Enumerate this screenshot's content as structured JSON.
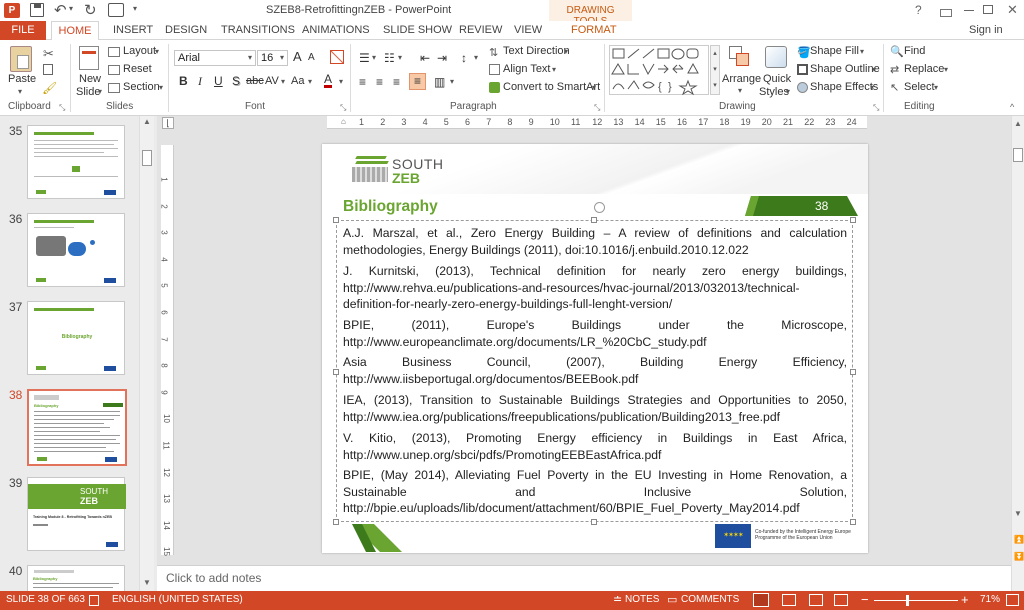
{
  "titlebar": {
    "title": "SZEB8-RetrofittingnZEB - PowerPoint",
    "context_group": "DRAWING TOOLS",
    "help": "?",
    "sign_in": "Sign in"
  },
  "tabs": [
    "FILE",
    "HOME",
    "INSERT",
    "DESIGN",
    "TRANSITIONS",
    "ANIMATIONS",
    "SLIDE SHOW",
    "REVIEW",
    "VIEW",
    "FORMAT"
  ],
  "ribbon": {
    "clipboard": {
      "label": "Clipboard",
      "paste": "Paste"
    },
    "slides": {
      "label": "Slides",
      "new_slide_1": "New",
      "new_slide_2": "Slide",
      "layout": "Layout",
      "reset": "Reset",
      "section": "Section"
    },
    "font": {
      "label": "Font",
      "font_name": "Arial",
      "font_size": "16",
      "bold": "B",
      "italic": "I",
      "underline": "U",
      "shadow": "S",
      "strike": "abc",
      "spacing": "AV",
      "case": "Aa",
      "color": "A",
      "grow": "A",
      "shrink": "A"
    },
    "paragraph": {
      "label": "Paragraph",
      "text_direction": "Text Direction",
      "align_text": "Align Text",
      "smartart": "Convert to SmartArt"
    },
    "drawing": {
      "label": "Drawing",
      "arrange": "Arrange",
      "quick_styles_1": "Quick",
      "quick_styles_2": "Styles",
      "shape_fill": "Shape Fill",
      "shape_outline": "Shape Outline",
      "shape_effects": "Shape Effects"
    },
    "editing": {
      "label": "Editing",
      "find": "Find",
      "replace": "Replace",
      "select": "Select"
    }
  },
  "thumbnails": [
    {
      "num": "35",
      "caption": ""
    },
    {
      "num": "36",
      "caption": ""
    },
    {
      "num": "37",
      "caption": "Bibliography"
    },
    {
      "num": "38",
      "caption": "Bibliography"
    },
    {
      "num": "39",
      "caption": "Training Module 8 - Retrofitting Towards nZEB"
    },
    {
      "num": "40",
      "caption": "Bibliography"
    }
  ],
  "thumb_39_logo_1": "SOUTH",
  "thumb_39_logo_2": "ZEB",
  "ruler_ticks": [
    "1",
    "2",
    "3",
    "4",
    "5",
    "6",
    "7",
    "8",
    "9",
    "10",
    "11",
    "12",
    "13",
    "14",
    "15",
    "16",
    "17",
    "18",
    "19",
    "20",
    "21",
    "22",
    "23",
    "24"
  ],
  "vruler_ticks": [
    "1",
    "2",
    "3",
    "4",
    "5",
    "6",
    "7",
    "8",
    "9",
    "10",
    "11",
    "12",
    "13",
    "14",
    "15"
  ],
  "slide": {
    "logo_south": "SOUTH",
    "logo_zeb": "ZEB",
    "title": "Bibliography",
    "page_number": "38",
    "eu_text": "Co-funded by the Intelligent Energy Europe Programme of the European Union",
    "entries": [
      "A.J. Marszal, et al., Zero Energy Building – A review of definitions and calculation methodologies, Energy Buildings (2011), doi:10.1016/j.enbuild.2010.12.022",
      "J. Kurnitski, (2013), Technical definition for nearly zero energy buildings, http://www.rehva.eu/publications-and-resources/hvac-journal/2013/032013/technical-definition-for-nearly-zero-energy-buildings-full-lenght-version/",
      "BPIE, (2011), Europe's Buildings under the Microscope, http://www.europeanclimate.org/documents/LR_%20CbC_study.pdf",
      "Asia Business Council, (2007), Building Energy Efficiency, http://www.iisbeportugal.org/documentos/BEEBook.pdf",
      "IEA, (2013), Transition to Sustainable Buildings Strategies and Opportunities to 2050, http://www.iea.org/publications/freepublications/publication/Building2013_free.pdf",
      "V. Kitio, (2013), Promoting Energy efficiency in Buildings in East Africa, http://www.unep.org/sbci/pdfs/PromotingEEBEastAfrica.pdf",
      "BPIE, (May 2014), Alleviating Fuel Poverty in the EU Investing in Home Renovation, a Sustainable and Inclusive Solution, http://bpie.eu/uploads/lib/document/attachment/60/BPIE_Fuel_Poverty_May2014.pdf"
    ]
  },
  "notes_placeholder": "Click to add notes",
  "status": {
    "slide_counter": "SLIDE 38 OF 663",
    "language": "ENGLISH (UNITED STATES)",
    "notes": "NOTES",
    "comments": "COMMENTS",
    "zoom": "71%"
  },
  "colors": {
    "accent": "#d24726",
    "green": "#6aa531",
    "dark_green": "#3d7a1c",
    "context": "#c55a11"
  }
}
